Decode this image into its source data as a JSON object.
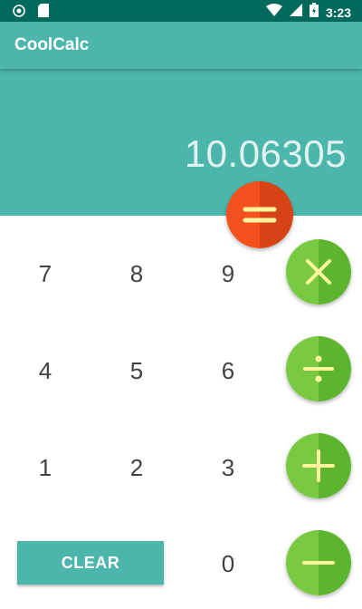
{
  "status_bar": {
    "time": "3:23",
    "icons": [
      "app-notification-icon",
      "sd-card-icon",
      "wifi-icon",
      "cell-signal-icon",
      "battery-icon"
    ]
  },
  "app_bar": {
    "title": "CoolCalc"
  },
  "display": {
    "value": "10.06305"
  },
  "keypad": {
    "row1": [
      "7",
      "8",
      "9"
    ],
    "row2": [
      "4",
      "5",
      "6"
    ],
    "row3": [
      "1",
      "2",
      "3"
    ],
    "zero": "0",
    "clear_label": "CLEAR"
  },
  "operators": [
    "equals",
    "multiply",
    "divide",
    "add",
    "subtract"
  ],
  "colors": {
    "status_bar": "#00695c",
    "primary": "#4db6ac",
    "operator_green": "#7ac943",
    "equals_orange": "#f4511e",
    "operator_symbol": "#fff59d",
    "digit_text": "#424242",
    "display_text": "#e0f2f1"
  }
}
